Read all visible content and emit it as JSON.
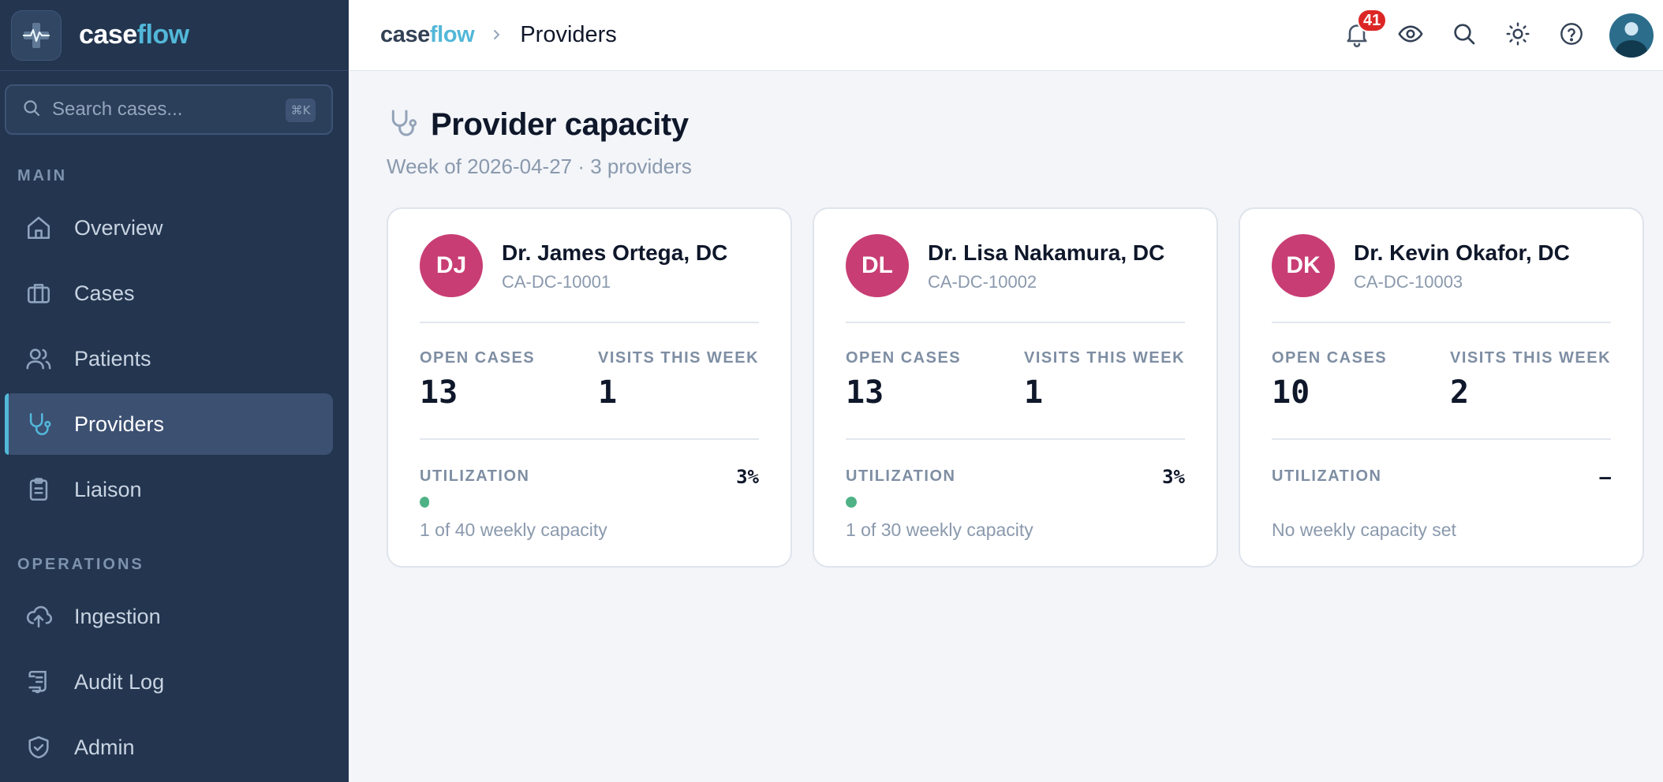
{
  "brand": {
    "part1": "case",
    "part2": "flow"
  },
  "search": {
    "placeholder": "Search cases...",
    "shortcut": "⌘K"
  },
  "sidebar": {
    "sections": [
      {
        "label": "MAIN"
      },
      {
        "label": "OPERATIONS"
      }
    ],
    "items": [
      {
        "label": "Overview",
        "icon": "home-icon"
      },
      {
        "label": "Cases",
        "icon": "briefcase-icon"
      },
      {
        "label": "Patients",
        "icon": "users-icon"
      },
      {
        "label": "Providers",
        "icon": "stethoscope-icon",
        "active": true
      },
      {
        "label": "Liaison",
        "icon": "clipboard-icon"
      },
      {
        "label": "Ingestion",
        "icon": "cloud-upload-icon"
      },
      {
        "label": "Audit Log",
        "icon": "scroll-icon"
      },
      {
        "label": "Admin",
        "icon": "shield-check-icon"
      }
    ]
  },
  "topbar": {
    "breadcrumb_page": "Providers",
    "notifications_count": "41"
  },
  "page": {
    "title": "Provider capacity",
    "subtitle": "Week of 2026-04-27 · 3 providers"
  },
  "labels": {
    "open_cases": "OPEN CASES",
    "visits_this_week": "VISITS THIS WEEK",
    "utilization": "UTILIZATION"
  },
  "providers": [
    {
      "initials": "DJ",
      "name": "Dr. James Ortega, DC",
      "id": "CA-DC-10001",
      "open_cases": "13",
      "visits": "1",
      "utilization": "3%",
      "utilization_fraction": 0.025,
      "capacity_note": "1 of 40 weekly capacity"
    },
    {
      "initials": "DL",
      "name": "Dr. Lisa Nakamura, DC",
      "id": "CA-DC-10002",
      "open_cases": "13",
      "visits": "1",
      "utilization": "3%",
      "utilization_fraction": 0.033,
      "capacity_note": "1 of 30 weekly capacity"
    },
    {
      "initials": "DK",
      "name": "Dr. Kevin Okafor, DC",
      "id": "CA-DC-10003",
      "open_cases": "10",
      "visits": "2",
      "utilization": "—",
      "utilization_fraction": 0,
      "capacity_note": "No weekly capacity set"
    }
  ],
  "colors": {
    "sidebar_bg": "#23354f",
    "accent": "#52b7d8",
    "avatar_bg": "#c83e74",
    "utilization_fill": "#4fb286",
    "badge": "#dc2626"
  }
}
